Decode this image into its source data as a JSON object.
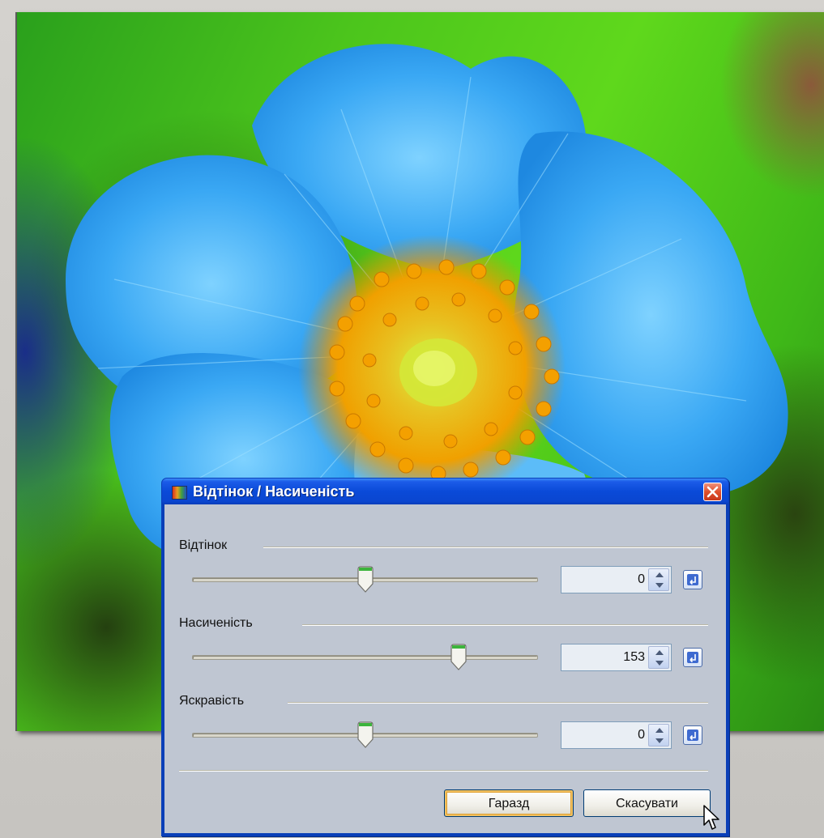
{
  "dialog": {
    "title": "Відтінок / Насиченість",
    "sliders": [
      {
        "label": "Відтінок",
        "value": "0",
        "level": 0.5
      },
      {
        "label": "Насиченість",
        "value": "153",
        "level": 0.77
      },
      {
        "label": "Яскравість",
        "value": "0",
        "level": 0.5
      }
    ],
    "buttons": {
      "ok": "Гаразд",
      "cancel": "Скасувати"
    }
  },
  "icons": {
    "app": "hue-saturation-icon",
    "close": "close-icon",
    "spin": "spin-up-down-icon",
    "reset": "reset-icon",
    "cursor": "mouse-pointer-icon"
  },
  "colors": {
    "titlebar": "#0a46d0",
    "close": "#e0502c",
    "flower": "#2a9cf0",
    "pollen": "#f0a000",
    "background": "#4cc51c"
  }
}
